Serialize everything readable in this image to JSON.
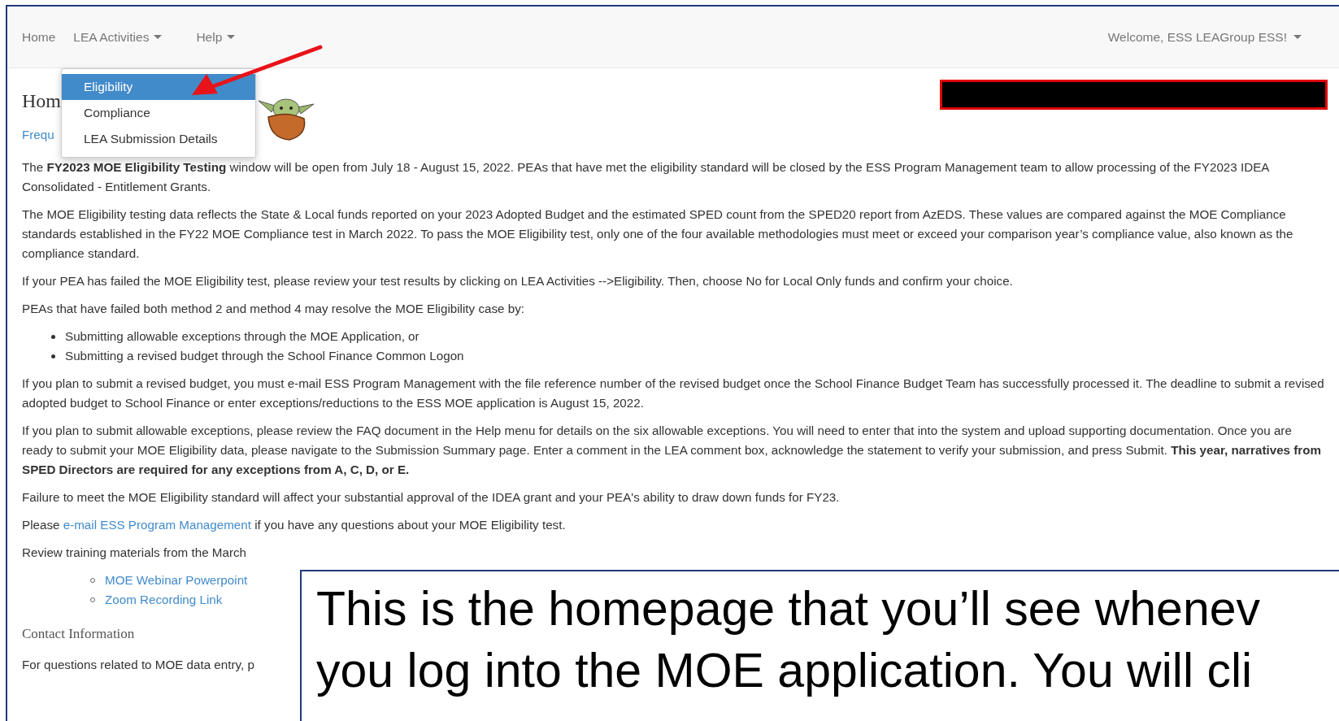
{
  "navbar": {
    "items": [
      {
        "label": "Home",
        "has_caret": false
      },
      {
        "label": "LEA Activities",
        "has_caret": true
      },
      {
        "label": "Help",
        "has_caret": true
      }
    ],
    "user_menu": "Welcome, ESS LEAGroup ESS!"
  },
  "dropdown": {
    "items": [
      {
        "label": "Eligibility",
        "selected": true
      },
      {
        "label": "Compliance",
        "selected": false
      },
      {
        "label": "LEA Submission Details",
        "selected": false
      }
    ]
  },
  "page": {
    "heading": "Hom",
    "faq_link": "Frequ",
    "blocks": [
      {
        "kind": "text",
        "text": "The **FY2023 MOE Eligibility Testing** window will be open from July 18 - August 15, 2022. PEAs that have met the eligibility standard will be closed by the ESS Program Management team to allow processing of the FY2023 IDEA Consolidated - Entitlement Grants."
      },
      {
        "kind": "text",
        "text": "The MOE Eligibility testing data reflects the State & Local funds reported on your 2023 Adopted Budget and the estimated SPED count from the SPED20 report from AzEDS. These values are compared against the MOE Compliance standards established in the FY22 MOE Compliance test in March 2022. To pass the MOE Eligibility test, only one of the four available methodologies must meet or exceed your comparison year’s compliance value, also known as the compliance standard."
      },
      {
        "kind": "text",
        "text": "If your PEA has failed the MOE Eligibility test, please review your test results by clicking on LEA Activities -->Eligibility. Then, choose No for Local Only funds and confirm your choice."
      },
      {
        "kind": "text",
        "text": "PEAs that have failed both method 2 and method 4 may resolve the MOE Eligibility case by:"
      },
      {
        "kind": "bullets",
        "items": [
          "Submitting allowable exceptions through the MOE Application, or",
          "Submitting a revised budget through the School Finance Common Logon"
        ]
      },
      {
        "kind": "text",
        "text": "If you plan to submit a revised budget, you must e-mail ESS Program Management with the file reference number of the revised budget once the School Finance Budget Team has successfully processed it. The deadline to submit a revised adopted budget to School Finance or enter exceptions/reductions to the ESS MOE application is August 15, 2022."
      },
      {
        "kind": "text",
        "text": "If you plan to submit allowable exceptions, please review the FAQ document in the Help menu for details on the six allowable exceptions. You will need to enter that into the system and upload supporting documentation. Once you are ready to submit your MOE Eligibility data, please navigate to the Submission Summary page. Enter a comment in the LEA comment box, acknowledge the statement to verify your submission, and press Submit. **This year, narratives from SPED Directors are required for any exceptions from A, C, D, or E.**"
      },
      {
        "kind": "text",
        "text": "Failure to meet the MOE Eligibility standard will affect your substantial approval of the IDEA grant and your PEA's ability to draw down funds for FY23."
      },
      {
        "kind": "link_sentence",
        "before": "Please",
        "link": "e-mail ESS Program Management",
        "after": "if you have any questions about your MOE Eligibility test."
      },
      {
        "kind": "text",
        "text": "Review training materials from the March"
      },
      {
        "kind": "link_list",
        "items": [
          "MOE Webinar Powerpoint",
          "Zoom Recording Link"
        ]
      },
      {
        "kind": "heading",
        "text": "Contact Information"
      },
      {
        "kind": "text",
        "text": "For questions related to MOE data entry, p"
      }
    ]
  },
  "callout": {
    "lines": [
      "This is the homepage that you’ll see whenev",
      "you log into the MOE application. You will cli"
    ]
  }
}
